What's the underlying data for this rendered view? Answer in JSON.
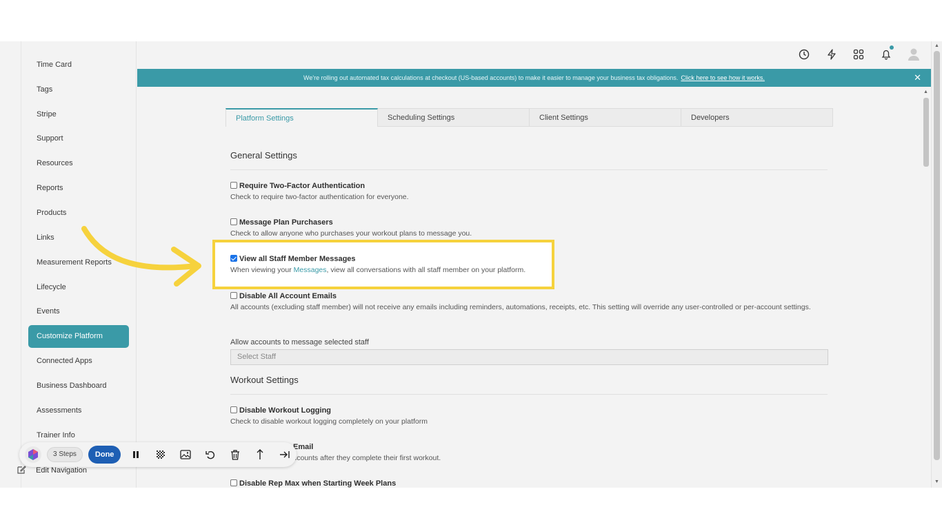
{
  "sidebar": {
    "items": [
      {
        "label": "Time Card"
      },
      {
        "label": "Tags"
      },
      {
        "label": "Stripe"
      },
      {
        "label": "Support"
      },
      {
        "label": "Resources"
      },
      {
        "label": "Reports"
      },
      {
        "label": "Products"
      },
      {
        "label": "Links"
      },
      {
        "label": "Measurement Reports"
      },
      {
        "label": "Lifecycle"
      },
      {
        "label": "Events"
      },
      {
        "label": "Customize Platform",
        "active": true
      },
      {
        "label": "Connected Apps"
      },
      {
        "label": "Business Dashboard"
      },
      {
        "label": "Assessments"
      },
      {
        "label": "Trainer Info"
      }
    ],
    "edit_nav_label": "Edit Navigation"
  },
  "topbar": {
    "icons": [
      "history-icon",
      "lightning-icon",
      "apps-grid-icon",
      "bell-icon",
      "user-avatar-icon"
    ]
  },
  "banner": {
    "text": "We're rolling out automated tax calculations at checkout (US-based accounts) to make it easier to manage your business tax obligations.",
    "link": "Click here to see how it works."
  },
  "tabs": [
    {
      "label": "Platform Settings",
      "active": true
    },
    {
      "label": "Scheduling Settings"
    },
    {
      "label": "Client Settings"
    },
    {
      "label": "Developers"
    }
  ],
  "general": {
    "title": "General Settings",
    "settings": [
      {
        "label": "Require Two-Factor Authentication",
        "desc": "Check to require two-factor authentication for everyone.",
        "checked": false
      },
      {
        "label": "Message Plan Purchasers",
        "desc": "Check to allow anyone who purchases your workout plans to message you.",
        "checked": false
      },
      {
        "label": "View all Staff Member Messages",
        "desc_prefix": "When viewing your",
        "desc_link": "Messages",
        "desc_suffix": ", view all conversations with all staff member on your platform.",
        "checked": true
      },
      {
        "label": "Disable All Account Emails",
        "desc": "All accounts (excluding staff member) will not receive any emails including reminders, automations, receipts, etc. This setting will override any user-controlled or per-account settings.",
        "checked": false
      }
    ],
    "staff_field_label": "Allow accounts to message selected staff",
    "staff_select_placeholder": "Select Staff"
  },
  "workout": {
    "title": "Workout Settings",
    "settings": [
      {
        "label": "Disable Workout Logging",
        "desc": "Check to disable workout logging completely on your platform",
        "checked": false
      },
      {
        "label_visible": "Email",
        "desc_visible": "ccounts after they complete their first workout.",
        "checked": false
      },
      {
        "label": "Disable Rep Max when Starting Week Plans",
        "checked": false
      }
    ]
  },
  "recorder": {
    "steps_label": "3 Steps",
    "done_label": "Done"
  },
  "colors": {
    "accent": "#3a9aa7",
    "highlight": "#f6d23d",
    "done_button": "#1e5fb4"
  }
}
